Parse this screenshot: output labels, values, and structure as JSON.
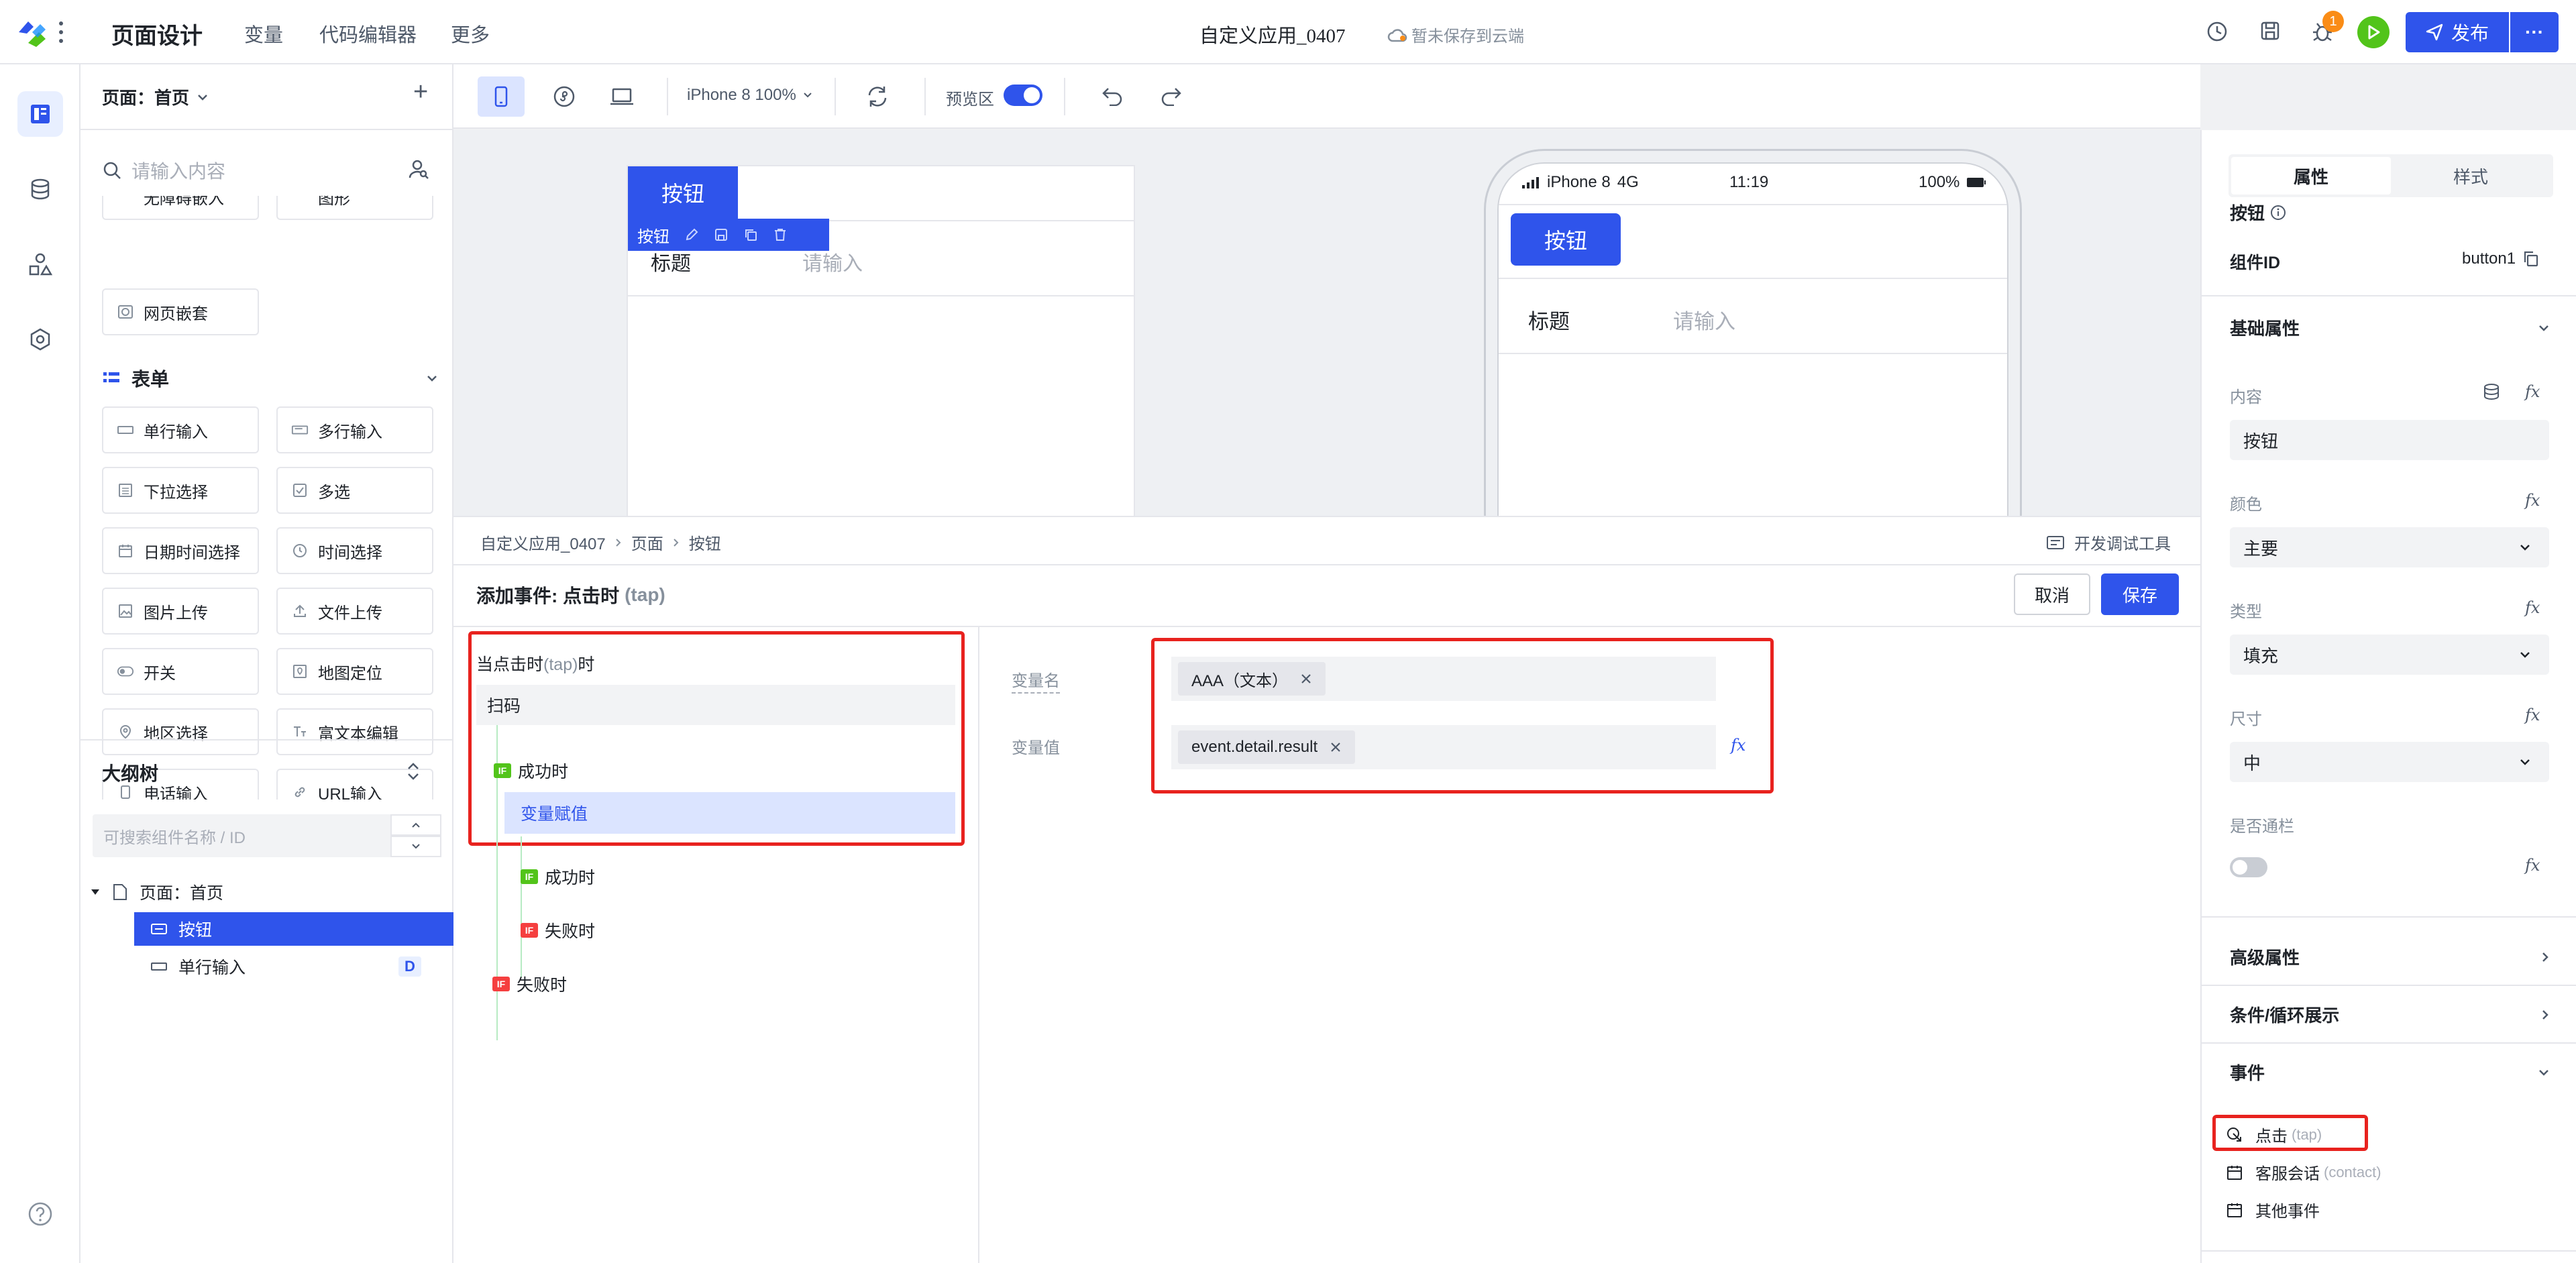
{
  "topbar": {
    "title": "页面设计",
    "nav": [
      "变量",
      "代码编辑器",
      "更多"
    ],
    "app_name": "自定义应用_0407",
    "save_status": "暂未保存到云端",
    "notification_count": "1",
    "publish_label": "发布",
    "more_label": "···"
  },
  "left_panel": {
    "page_selector": "页面：首页",
    "add_label": "+",
    "search_placeholder": "请输入内容",
    "partial_items": [
      "无障碍嵌入",
      "图形"
    ],
    "embed_item": "网页嵌套",
    "form_section_title": "表单",
    "form_items": [
      "单行输入",
      "多行输入",
      "下拉选择",
      "多选",
      "日期时间选择",
      "时间选择",
      "图片上传",
      "文件上传",
      "开关",
      "地图定位",
      "地区选择",
      "富文本编辑",
      "电话输入",
      "URL输入"
    ],
    "outline_title": "大纲树",
    "outline_search_placeholder": "可搜索组件名称 / ID",
    "tree": {
      "root": "页面：首页",
      "selected": "按钮",
      "child2": "单行输入",
      "child2_badge": "D"
    }
  },
  "toolbar": {
    "device": "iPhone 8 100%",
    "preview_label": "预览区"
  },
  "canvas": {
    "button_label": "按钮",
    "floating_label": "按钮",
    "field_label": "标题",
    "field_placeholder": "请输入"
  },
  "phone": {
    "carrier": "iPhone 8",
    "network": "4G",
    "time": "11:19",
    "battery": "100%",
    "button_label": "按钮",
    "field_label": "标题",
    "field_placeholder": "请输入"
  },
  "event_panel": {
    "breadcrumb": [
      "自定义应用_0407",
      "页面",
      "按钮"
    ],
    "debug_tool": "开发调试工具",
    "title": "添加事件: 点击时",
    "title_suffix": "(tap)",
    "cancel_label": "取消",
    "save_label": "保存",
    "flow": {
      "trigger_prefix": "当点击时",
      "trigger_tap": "(tap)",
      "trigger_suffix": "时",
      "action": "扫码",
      "if_badge": "IF",
      "success": "成功时",
      "assign": "变量赋值",
      "success2": "成功时",
      "fail2": "失败时",
      "fail": "失败时"
    },
    "form": {
      "var_name_label": "变量名",
      "var_name_tag": "AAA（文本）",
      "var_value_label": "变量值",
      "var_value_tag": "event.detail.result",
      "fx": "fx"
    }
  },
  "right_panel": {
    "tabs": [
      "属性",
      "样式"
    ],
    "component_title": "按钮",
    "component_id_label": "组件ID",
    "component_id": "button1",
    "basic_section": "基础属性",
    "content_label": "内容",
    "content_value": "按钮",
    "color_label": "颜色",
    "color_value": "主要",
    "type_label": "类型",
    "type_value": "填充",
    "size_label": "尺寸",
    "size_value": "中",
    "full_label": "是否通栏",
    "fx": "fx",
    "advanced_section": "高级属性",
    "condition_section": "条件/循环展示",
    "events_section": "事件",
    "events": [
      {
        "label": "点击",
        "code": "(tap)"
      },
      {
        "label": "客服会话",
        "code": "(contact)"
      },
      {
        "label": "其他事件",
        "code": ""
      }
    ]
  },
  "colors": {
    "primary": "#2f54eb",
    "highlight_red": "#e8221e",
    "success_green": "#52c41a",
    "danger_red": "#f53f3f",
    "badge_orange": "#fa8c16"
  },
  "icons": [
    "logo-icon",
    "grid-icon",
    "help-icon",
    "history-icon",
    "save-icon",
    "bug-icon",
    "play-icon",
    "send-icon",
    "page-icon",
    "database-icon",
    "shapes-icon",
    "hexagon-icon",
    "search-icon",
    "user-search-icon",
    "mobile-icon",
    "mini-program-icon",
    "laptop-icon",
    "refresh-icon",
    "undo-icon",
    "redo-icon",
    "cloud-icon",
    "info-icon",
    "copy-icon",
    "chevron-down-icon",
    "chevron-right-icon",
    "close-icon",
    "tap-icon",
    "calendar-icon",
    "edit-icon",
    "delete-icon"
  ]
}
